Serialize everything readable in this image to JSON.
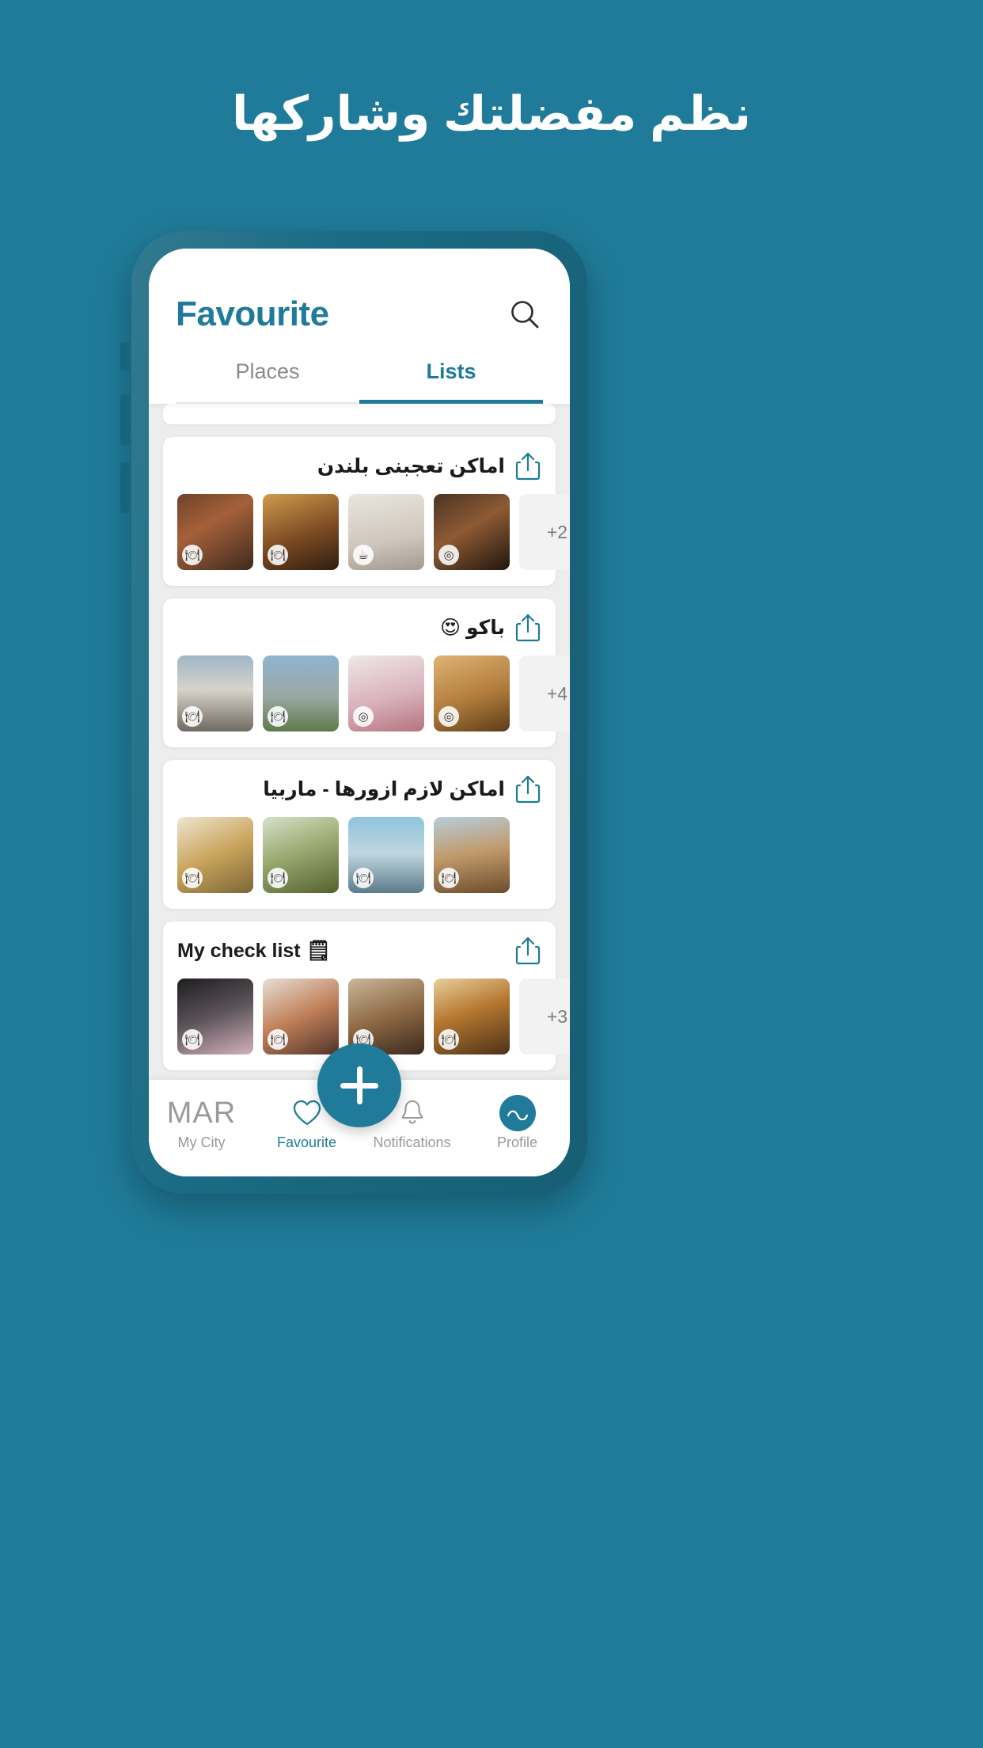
{
  "promo": {
    "headline": "نظم مفضلتك وشاركها"
  },
  "app": {
    "title": "Favourite",
    "search_icon": "search-icon",
    "tabs": [
      {
        "label": "Places",
        "active": false
      },
      {
        "label": "Lists",
        "active": true
      }
    ]
  },
  "lists": [
    {
      "title": "اماكن تعجبنى بلندن",
      "dir": "rtl",
      "share_icon": "share-icon",
      "thumbs": [
        {
          "art": "t-lobster",
          "badge": "🍽"
        },
        {
          "art": "t-burger",
          "badge": "🍽"
        },
        {
          "art": "t-icecream",
          "badge": "☕"
        },
        {
          "art": "t-brunch",
          "badge": "◎"
        }
      ],
      "more_count": "+2"
    },
    {
      "title": "باكو 😍",
      "dir": "rtl",
      "share_icon": "share-icon",
      "thumbs": [
        {
          "art": "t-palace",
          "badge": "🍽"
        },
        {
          "art": "t-field",
          "badge": "🍽"
        },
        {
          "art": "t-cake",
          "badge": "◎"
        },
        {
          "art": "t-pastry",
          "badge": "◎"
        }
      ],
      "more_count": "+4"
    },
    {
      "title": "اماكن لازم  ازورها - ماربيا",
      "dir": "rtl",
      "share_icon": "share-icon",
      "thumbs": [
        {
          "art": "t-fish",
          "badge": "🍽"
        },
        {
          "art": "t-salad",
          "badge": "🍽"
        },
        {
          "art": "t-coast",
          "badge": "🍽"
        },
        {
          "art": "t-terrace",
          "badge": "🍽"
        }
      ],
      "more_count": ""
    },
    {
      "title": "My check list 🗒",
      "dir": "ltr",
      "share_icon": "share-icon",
      "thumbs": [
        {
          "art": "t-dessert",
          "badge": "🍽"
        },
        {
          "art": "t-plate",
          "badge": "🍽"
        },
        {
          "art": "t-seafood",
          "badge": "🍽"
        },
        {
          "art": "t-grill",
          "badge": "🍽"
        }
      ],
      "more_count": "+3"
    }
  ],
  "bottom_nav": {
    "items": [
      {
        "label": "My City",
        "icon": "city-brand-icon",
        "brand_text": "MAR",
        "active": false
      },
      {
        "label": "Favourite",
        "icon": "heart-icon",
        "active": true
      },
      {
        "label": "Notifications",
        "icon": "bell-icon",
        "active": false
      },
      {
        "label": "Profile",
        "icon": "avatar-icon",
        "active": false
      }
    ],
    "fab": {
      "icon": "plus-icon",
      "label": ""
    }
  },
  "colors": {
    "brand": "#1f7b99",
    "background": "#1f7b99",
    "card": "#ffffff",
    "list_bg": "#eceded",
    "muted_text": "#8a8a8a"
  }
}
